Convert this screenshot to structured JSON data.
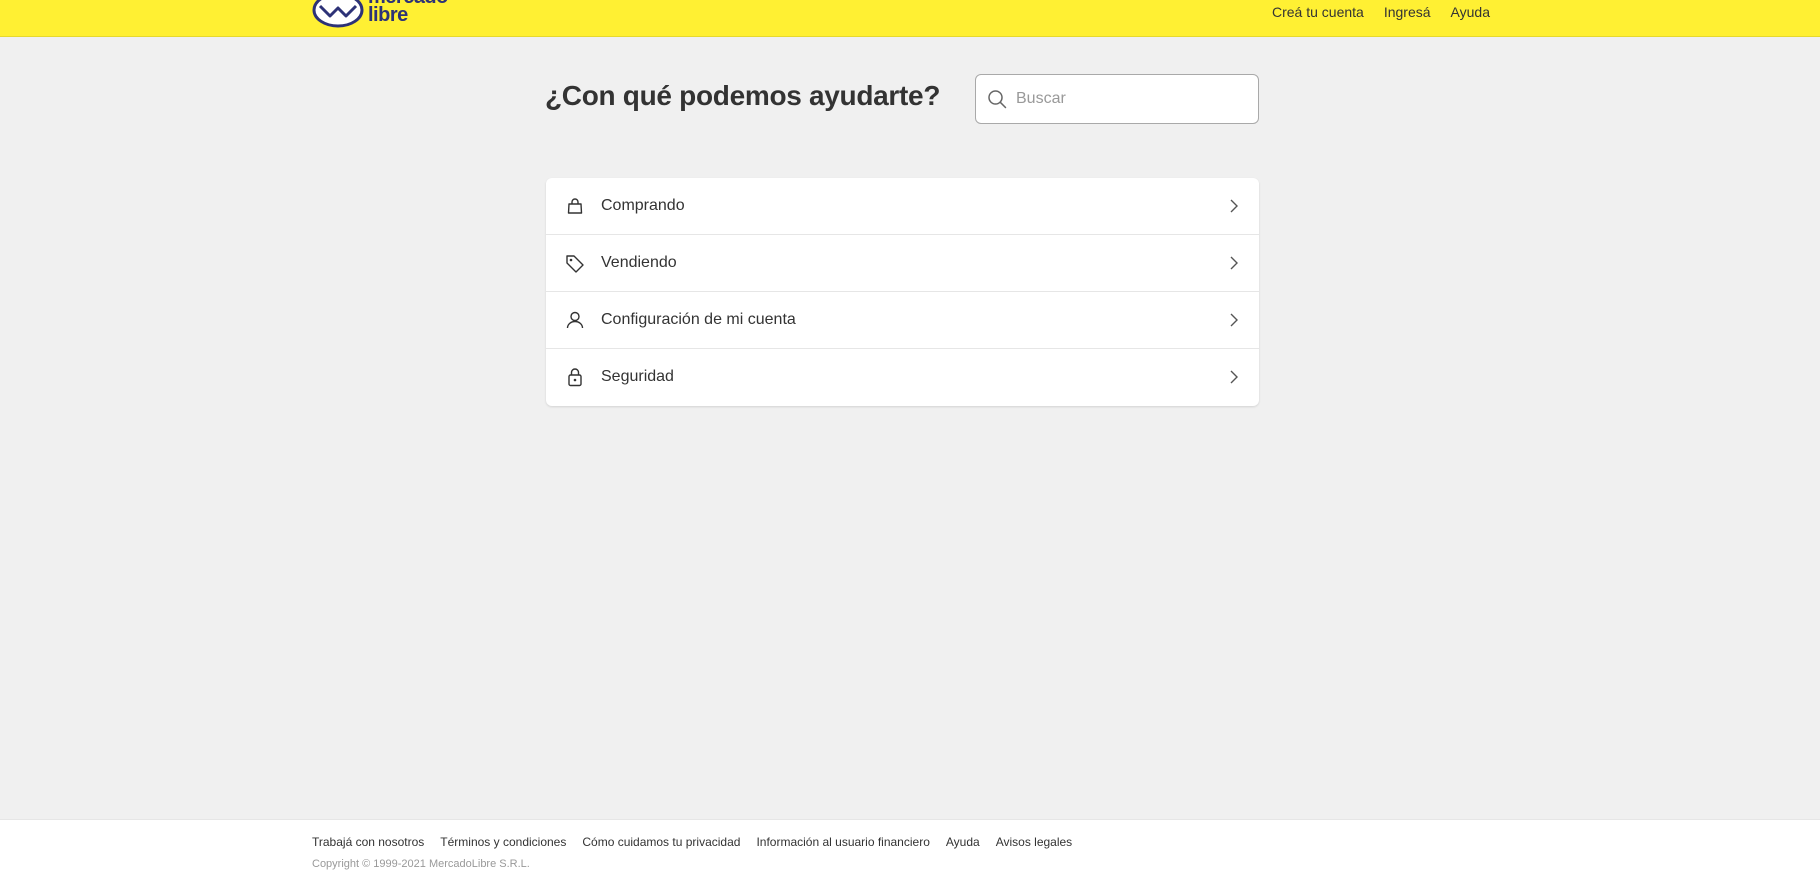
{
  "header": {
    "logo_line1": "mercado",
    "logo_line2": "libre",
    "nav": [
      {
        "label": "Creá tu cuenta"
      },
      {
        "label": "Ingresá"
      },
      {
        "label": "Ayuda"
      }
    ]
  },
  "hero": {
    "title": "¿Con qué podemos ayudarte?"
  },
  "search": {
    "placeholder": "Buscar",
    "value": ""
  },
  "menu": {
    "items": [
      {
        "label": "Comprando",
        "icon": "shopping-bag-icon"
      },
      {
        "label": "Vendiendo",
        "icon": "price-tag-icon"
      },
      {
        "label": "Configuración de mi cuenta",
        "icon": "user-icon"
      },
      {
        "label": "Seguridad",
        "icon": "lock-icon"
      }
    ]
  },
  "footer": {
    "links": [
      {
        "label": "Trabajá con nosotros"
      },
      {
        "label": "Términos y condiciones"
      },
      {
        "label": "Cómo cuidamos tu privacidad"
      },
      {
        "label": "Información al usuario financiero"
      },
      {
        "label": "Ayuda"
      },
      {
        "label": "Avisos legales"
      }
    ],
    "copyright": "Copyright © 1999-2021 MercadoLibre S.R.L."
  },
  "colors": {
    "header_bg": "#fff033",
    "page_bg": "#f0f0f0",
    "brand_blue": "#2d3277"
  }
}
